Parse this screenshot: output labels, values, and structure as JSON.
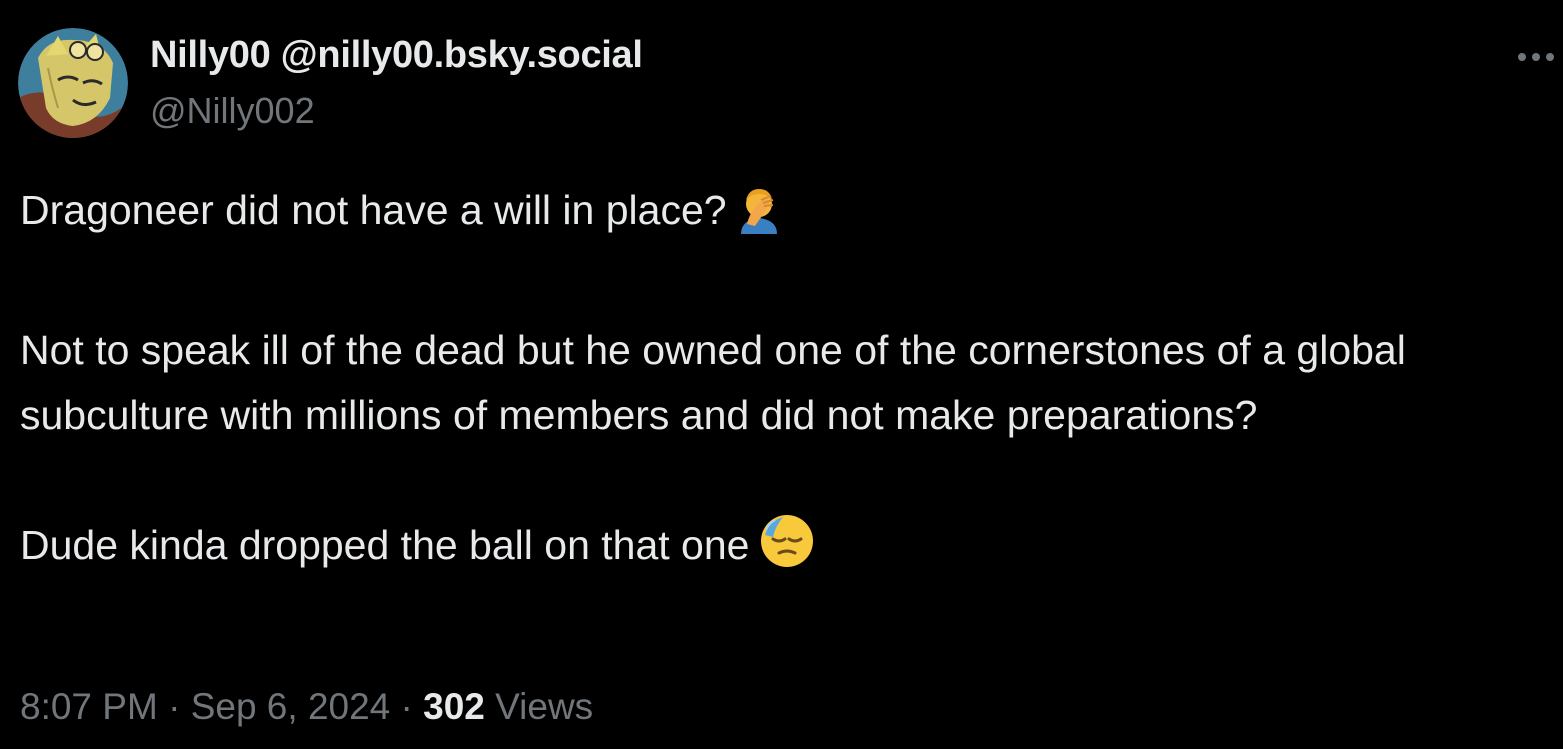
{
  "author": {
    "display_name": "Nilly00 @nilly00.bsky.social",
    "handle": "@Nilly002",
    "avatar_icon": "avatar-image"
  },
  "menu": {
    "icon": "more-options-icon"
  },
  "post": {
    "line1": "Dragoneer did not have a will in place?",
    "line1_emoji": "facepalm-emoji",
    "paragraph2": "Not to speak ill of the dead but he owned one of the cornerstones of a global subculture with millions of members and did not make preparations?",
    "line3": "Dude kinda dropped the ball on that one",
    "line3_emoji": "sweat-face-emoji"
  },
  "meta": {
    "time": "8:07 PM",
    "separator": "·",
    "date": "Sep 6, 2024",
    "views_count": "302",
    "views_label": "Views"
  },
  "colors": {
    "background": "#000000",
    "primary_text": "#e7e9ea",
    "secondary_text": "#71767b"
  }
}
